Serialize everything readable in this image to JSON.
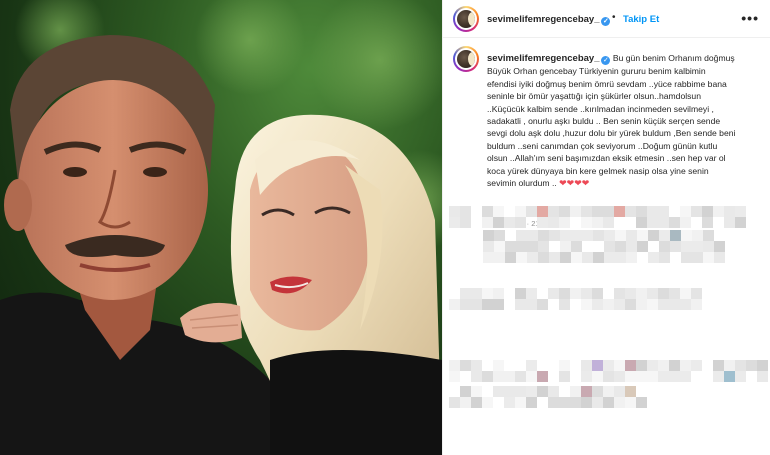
{
  "post": {
    "username": "sevimelifemregencebay_",
    "verified_mark": "✓",
    "dot": "•",
    "follow_label": "Takip Et",
    "more_icon": "•••",
    "caption_lines": [
      "Bu gün benim Orhanım doğmuş",
      "Büyük Orhan gencebay Türkiyenin gururu benim kalbimin",
      "efendisi iyiki doğmuş benim ömrü sevdam ..yüce rabbime bana",
      "seninle bir ömür yaşattığı için şükürler olsun..hamdolsun",
      "..Küçücük kalbim sende ..kırılmadan incinmeden sevilmeyi ,",
      "sadakatli , onurlu aşkı buldu .. Ben senin küçük serçen sende",
      "sevgi dolu aşk dolu ,huzur dolu bir yürek buldum ,Ben sende beni",
      "buldum ..seni canımdan çok seviyorum ..Doğum günün kutlu",
      "olsun ..Allah'ım seni başımızdan eksik etmesin ..sen hep var ol",
      "koca yürek dünyaya bin kere gelmek nasip olsa yine senin",
      "sevimin olurdum .."
    ],
    "hearts": "❤❤❤❤",
    "edited": "Düzenlendi · 21s"
  },
  "icons": {
    "avatar": "profile-avatar-icon",
    "verified": "verified-badge-icon",
    "more": "more-options-icon"
  },
  "colors": {
    "accent": "#0095f6",
    "verified": "#3897f0",
    "heart": "#ed4956",
    "muted": "#8e8e8e"
  }
}
